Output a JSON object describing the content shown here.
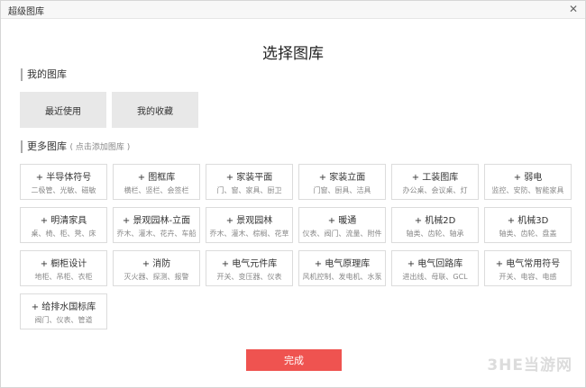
{
  "window": {
    "title": "超级图库",
    "close_glyph": "✕"
  },
  "heading": "选择图库",
  "my_library": {
    "label": "我的图库",
    "buttons": [
      "最近使用",
      "我的收藏"
    ]
  },
  "more_library": {
    "label": "更多图库",
    "hint": "( 点击添加图库 )",
    "cards": [
      {
        "name": "+ 半导体符号",
        "desc": "二极管、光敏、磁敏"
      },
      {
        "name": "+ 图框库",
        "desc": "横栏、竖栏、会签栏"
      },
      {
        "name": "+ 家装平面",
        "desc": "门、窗、家具、厨卫"
      },
      {
        "name": "+ 家装立面",
        "desc": "门窗、厨具、洁具"
      },
      {
        "name": "+ 工装图库",
        "desc": "办公桌、会议桌、灯"
      },
      {
        "name": "+ 弱电",
        "desc": "监控、安防、智能家具"
      },
      {
        "name": "+ 明清家具",
        "desc": "桌、椅、柜、凳、床"
      },
      {
        "name": "+ 景观园林-立面",
        "desc": "乔木、灌木、花卉、车船"
      },
      {
        "name": "+ 景观园林",
        "desc": "乔木、灌木、棕榈、花草"
      },
      {
        "name": "+ 暖通",
        "desc": "仪表、阀门、流量、附件"
      },
      {
        "name": "+ 机械2D",
        "desc": "轴类、齿轮、轴承"
      },
      {
        "name": "+ 机械3D",
        "desc": "轴类、齿轮、盘盖"
      },
      {
        "name": "+ 橱柜设计",
        "desc": "地柜、吊柜、衣柜"
      },
      {
        "name": "+ 消防",
        "desc": "灭火器、探测、报警"
      },
      {
        "name": "+ 电气元件库",
        "desc": "开关、变压器、仪表"
      },
      {
        "name": "+ 电气原理库",
        "desc": "风机控制、发电机、水泵"
      },
      {
        "name": "+ 电气回路库",
        "desc": "进出线、母联、GCL"
      },
      {
        "name": "+ 电气常用符号",
        "desc": "开关、电容、电感"
      },
      {
        "name": "+ 给排水国标库",
        "desc": "阀门、仪表、管道"
      }
    ]
  },
  "done_label": "完成",
  "watermark": "3HE当游网"
}
